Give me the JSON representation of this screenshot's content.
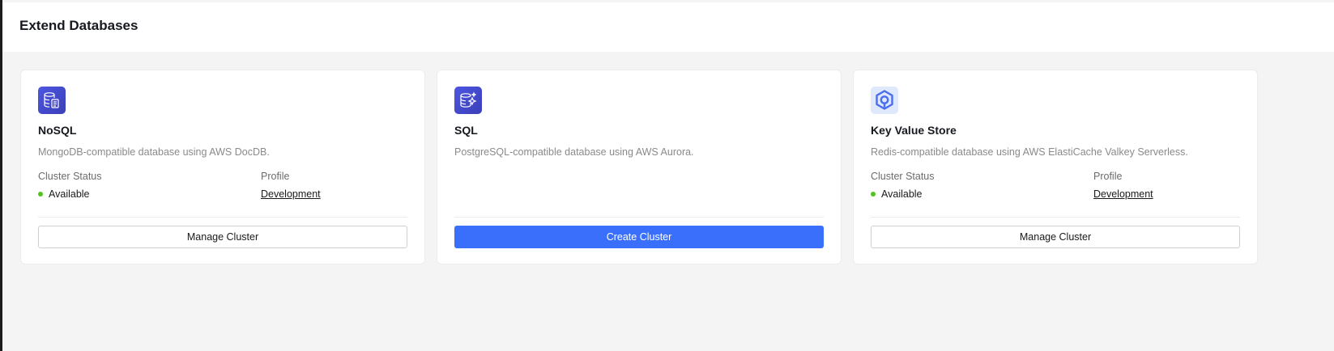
{
  "header": {
    "title": "Extend Databases"
  },
  "cards": [
    {
      "icon": "nosql-database-icon",
      "title": "NoSQL",
      "description": "MongoDB-compatible database using AWS DocDB.",
      "status_label": "Cluster Status",
      "status_value": "Available",
      "profile_label": "Profile",
      "profile_value": "Development",
      "button_label": "Manage Cluster"
    },
    {
      "icon": "sql-database-icon",
      "title": "SQL",
      "description": "PostgreSQL-compatible database using AWS Aurora.",
      "button_label": "Create Cluster"
    },
    {
      "icon": "key-value-store-icon",
      "title": "Key Value Store",
      "description": "Redis-compatible database using AWS ElastiCache Valkey Serverless.",
      "status_label": "Cluster Status",
      "status_value": "Available",
      "profile_label": "Profile",
      "profile_value": "Development",
      "button_label": "Manage Cluster"
    }
  ],
  "colors": {
    "primary": "#3a6ffb",
    "status_available": "#52c41a",
    "icon_purple": "#4c56e0"
  }
}
